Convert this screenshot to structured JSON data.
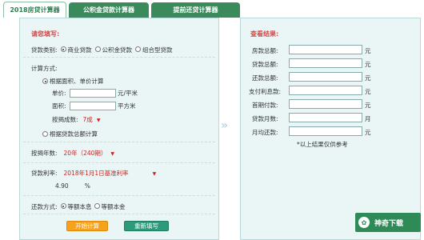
{
  "tabs": [
    {
      "label": "2018房贷计算器",
      "active": true
    },
    {
      "label": "公积金贷款计算器",
      "active": false
    },
    {
      "label": "提前还贷计算器",
      "active": false
    }
  ],
  "form": {
    "title": "请您填写:",
    "loan_type_label": "贷款类别:",
    "loan_types": [
      "商业贷款",
      "公积金贷款",
      "组合型贷款"
    ],
    "calc_method_label": "计算方式:",
    "method_area": "根据面积、单价计算",
    "unit_price_label": "单价:",
    "unit_price_unit": "元/平米",
    "area_label": "面积:",
    "area_unit": "平方米",
    "ratio_label": "按揭成数:",
    "ratio_value": "7成",
    "method_total": "根据贷款总额计算",
    "years_label": "按揭年数:",
    "years_value": "20年（240期）",
    "rate_label": "贷款利率:",
    "rate_value": "2018年1月1日基准利率",
    "rate_number": "4.90",
    "rate_unit": "%",
    "repay_label": "还款方式:",
    "repay_options": [
      "等额本息",
      "等额本金"
    ],
    "calc_button": "开始计算",
    "reset_button": "重新填写"
  },
  "result": {
    "title": "查看结果:",
    "fields": [
      {
        "label": "房款总额:",
        "unit": "元"
      },
      {
        "label": "贷款总额:",
        "unit": "元"
      },
      {
        "label": "还款总额:",
        "unit": "元"
      },
      {
        "label": "支付利息款:",
        "unit": "元"
      },
      {
        "label": "首期付款:",
        "unit": "元"
      },
      {
        "label": "贷款月数:",
        "unit": "月"
      },
      {
        "label": "月均还款:",
        "unit": "元"
      }
    ],
    "note": "*以上结果仅供参考"
  },
  "watermark": {
    "text": "神奇下载"
  },
  "colors": {
    "tab_green": "#3b8a5c",
    "panel_bg": "#eaf6f6",
    "title_red": "#d24c4c",
    "button_orange": "#f7a21b",
    "button_teal": "#2d9a7c"
  }
}
